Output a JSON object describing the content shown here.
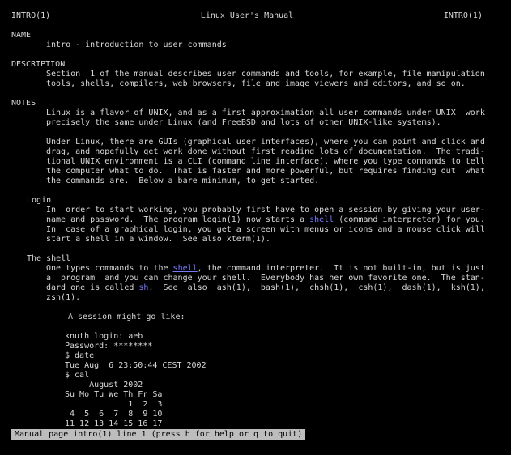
{
  "header": {
    "left": "INTRO(1)",
    "center": "Linux User's Manual",
    "right": "INTRO(1)"
  },
  "name": {
    "heading": "NAME",
    "text": "intro - introduction to user commands"
  },
  "description": {
    "heading": "DESCRIPTION",
    "lines": [
      "Section  1 of the manual describes user commands and tools, for example, file manipulation",
      "tools, shells, compilers, web browsers, file and image viewers and editors, and so on."
    ]
  },
  "notes": {
    "heading": "NOTES",
    "para1": [
      "Linux is a flavor of UNIX, and as a first approximation all user commands under UNIX  work",
      "precisely the same under Linux (and FreeBSD and lots of other UNIX-like systems)."
    ],
    "para2": [
      "Under Linux, there are GUIs (graphical user interfaces), where you can point and click and",
      "drag, and hopefully get work done without first reading lots of documentation.  The tradi-",
      "tional UNIX environment is a CLI (command line interface), where you type commands to tell",
      "the computer what to do.  That is faster and more powerful, but requires finding out  what",
      "the commands are.  Below a bare minimum, to get started."
    ]
  },
  "login": {
    "heading": "Login",
    "line1": "In  order to start working, you probably first have to open a session by giving your user-",
    "line2_pre": "name and password.  The program login(1) now starts a ",
    "line2_link": "shell",
    "line2_post": " (command interpreter) for you.",
    "line3": "In  case of a graphical login, you get a screen with menus or icons and a mouse click will",
    "line4": "start a shell in a window.  See also xterm(1)."
  },
  "shell": {
    "heading": "The shell",
    "line1_pre": "One types commands to the ",
    "line1_link": "shell",
    "line1_post": ", the command interpreter.  It is not built-in, but is just",
    "line2": "a  program  and you can change your shell.  Everybody has her own favorite one.  The stan-",
    "line3_pre": "dard one is called ",
    "line3_link": "sh",
    "line3_post": ".  See  also  ash(1),  bash(1),  chsh(1),  csh(1),  dash(1),  ksh(1),",
    "line4": "zsh(1).",
    "session_intro": "A session might go like:",
    "session_lines": [
      "knuth login: aeb",
      "Password: ********",
      "$ date",
      "Tue Aug  6 23:50:44 CEST 2002",
      "$ cal",
      "     August 2002",
      "Su Mo Tu We Th Fr Sa",
      "             1  2  3",
      " 4  5  6  7  8  9 10",
      "11 12 13 14 15 16 17"
    ]
  },
  "status": {
    "text": "Manual page intro(1) line 1 (press h for help or q to quit)"
  },
  "colors": {
    "background": "#000000",
    "text": "#d8d8d8",
    "link": "#7a7aff",
    "status_bg": "#bdbdbd",
    "status_fg": "#000000"
  }
}
